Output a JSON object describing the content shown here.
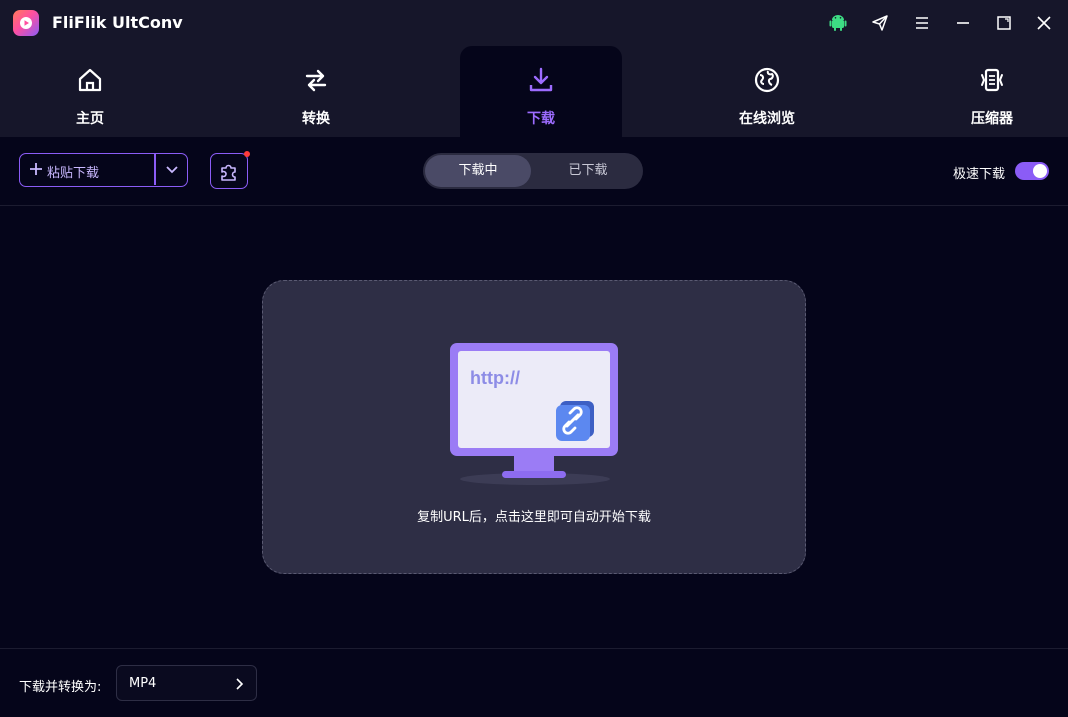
{
  "app": {
    "title": "FliFlik UltConv"
  },
  "titlebar_icons": [
    "android-icon",
    "send-icon",
    "menu-icon",
    "minimize-icon",
    "maximize-icon",
    "close-icon"
  ],
  "nav": {
    "tabs": [
      {
        "label": "主页",
        "icon": "home-icon",
        "active": false
      },
      {
        "label": "转换",
        "icon": "convert-icon",
        "active": false
      },
      {
        "label": "下载",
        "icon": "download-icon",
        "active": true
      },
      {
        "label": "在线浏览",
        "icon": "globe-icon",
        "active": false
      },
      {
        "label": "压缩器",
        "icon": "compress-icon",
        "active": false
      }
    ]
  },
  "toolbar": {
    "paste_label": "粘贴下载",
    "segments": [
      "下载中",
      "已下载"
    ],
    "speed_label": "极速下载",
    "speed_enabled": true
  },
  "dropzone": {
    "screen_text": "http://",
    "hint": "复制URL后，点击这里即可自动开始下载"
  },
  "footer": {
    "format_label": "下载并转换为:",
    "format_value": "MP4"
  },
  "colors": {
    "accent": "#8b5cf6",
    "background": "#05051a",
    "titlebar": "#16162a",
    "android": "#3ddc84"
  }
}
